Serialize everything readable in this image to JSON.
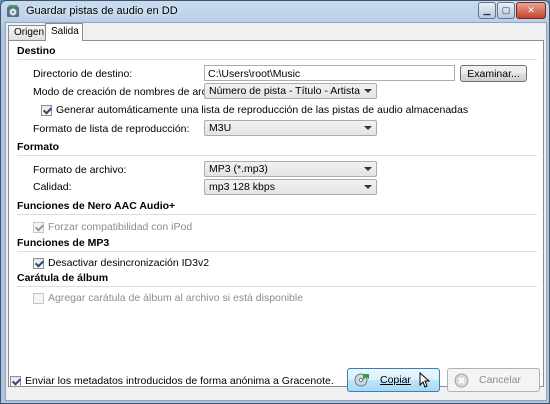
{
  "window": {
    "title": "Guardar pistas de audio en DD"
  },
  "tabs": [
    {
      "label": "Origen"
    },
    {
      "label": "Salida"
    }
  ],
  "destino": {
    "section_title": "Destino",
    "dir_label": "Directorio de destino:",
    "dir_value": "C:\\Users\\root\\Music",
    "browse_label": "Examinar...",
    "naming_label": "Modo de creación de nombres de archivo:",
    "naming_value": "Número de pista - Título - Artista",
    "playlist_checkbox_label": "Generar automáticamente una lista de reproducción de las pistas de audio almacenadas",
    "playlist_checked": true,
    "playlist_format_label": "Formato de lista de reproducción:",
    "playlist_format_value": "M3U"
  },
  "formato": {
    "section_title": "Formato",
    "file_format_label": "Formato de archivo:",
    "file_format_value": "MP3 (*.mp3)",
    "quality_label": "Calidad:",
    "quality_value": "mp3 128 kbps"
  },
  "nero_aac": {
    "section_title": "Funciones de Nero AAC Audio+",
    "ipod_label": "Forzar compatibilidad con iPod",
    "ipod_checked": true
  },
  "mp3": {
    "section_title": "Funciones de MP3",
    "id3_label": "Desactivar desincronización ID3v2",
    "id3_checked": true
  },
  "caratula": {
    "section_title": "Carátula de álbum",
    "add_cover_label": "Agregar carátula de álbum al archivo si está disponible",
    "add_cover_checked": false
  },
  "footer": {
    "gracenote_label": "Enviar los metadatos introducidos de forma anónima a Gracenote.",
    "gracenote_checked": true,
    "copy_label": "Copiar",
    "cancel_label": "Cancelar"
  }
}
